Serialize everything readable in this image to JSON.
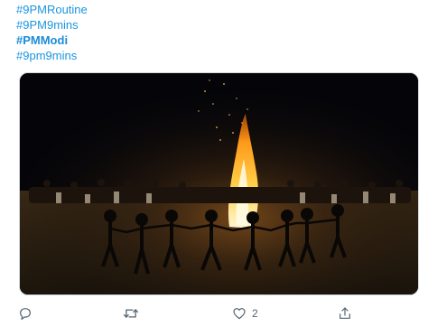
{
  "tweet": {
    "hashtags": [
      {
        "text": "#9PMRoutine",
        "bold": false
      },
      {
        "text": "#9PM9mins",
        "bold": false
      },
      {
        "text": "#PMModi",
        "bold": true
      },
      {
        "text": "#9pm9mins",
        "bold": false
      }
    ],
    "media": {
      "icon": "bonfire-photo"
    },
    "actions": {
      "reply": {
        "icon": "reply-icon"
      },
      "retweet": {
        "icon": "retweet-icon"
      },
      "like": {
        "icon": "heart-icon",
        "count": "2"
      },
      "share": {
        "icon": "share-icon"
      }
    }
  },
  "colors": {
    "link": "#1b95e0",
    "icon": "#536471",
    "fire": "#ffb02e"
  }
}
